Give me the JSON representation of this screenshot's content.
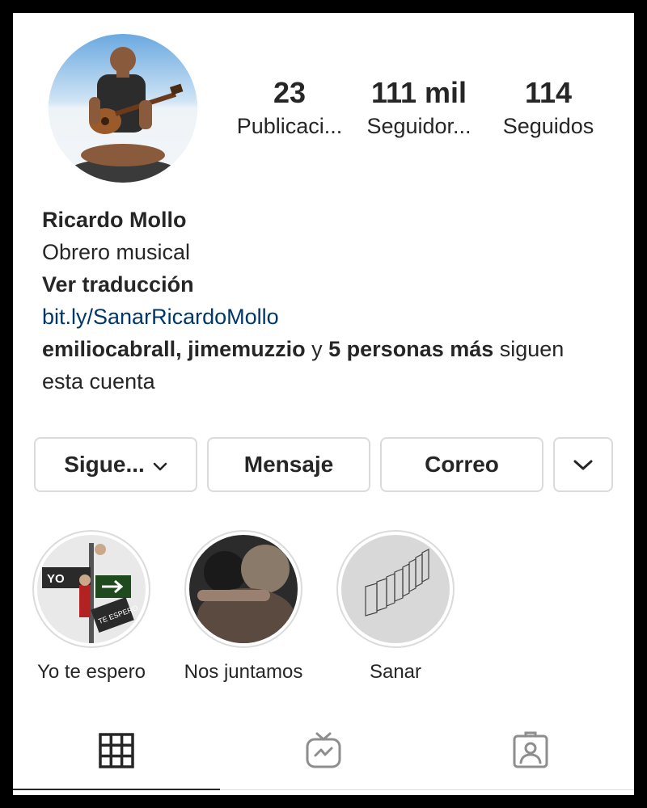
{
  "profile": {
    "name": "Ricardo Mollo",
    "bio": "Obrero musical",
    "translate_label": "Ver traducción",
    "link": "bit.ly/SanarRicardoMollo",
    "followed_by": {
      "user1": "emiliocabrall",
      "sep": ", ",
      "user2": "jimemuzzio",
      "conj": " y ",
      "others": "5 personas más",
      "suffix": " siguen esta cuenta"
    }
  },
  "stats": [
    {
      "value": "23",
      "label": "Publicaci..."
    },
    {
      "value": "111 mil",
      "label": "Seguidor..."
    },
    {
      "value": "114",
      "label": "Seguidos"
    }
  ],
  "actions": {
    "following": "Sigue...",
    "message": "Mensaje",
    "email": "Correo"
  },
  "highlights": [
    {
      "label": "Yo te espero",
      "sign_left": "YO",
      "sign_right": "TE ESPERO"
    },
    {
      "label": "Nos juntamos"
    },
    {
      "label": "Sanar"
    }
  ],
  "tabs": {
    "grid_icon": "grid-icon",
    "igtv_icon": "igtv-icon",
    "tagged_icon": "tagged-icon",
    "active": "grid"
  },
  "colors": {
    "text": "#262626",
    "link": "#00376b",
    "border": "#dbdbdb",
    "frame": "#000000"
  }
}
